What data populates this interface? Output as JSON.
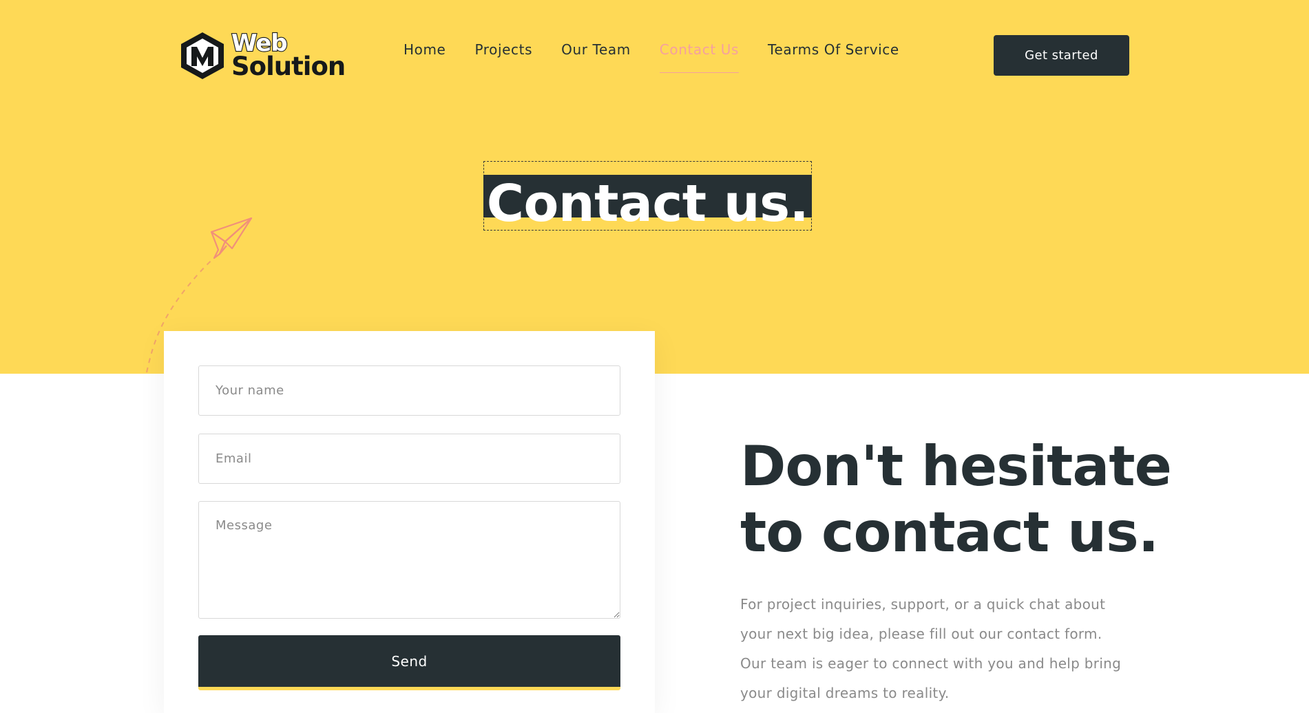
{
  "header": {
    "logo": {
      "line1": "Web",
      "line2": "Solution"
    },
    "nav": [
      {
        "label": "Home",
        "active": false
      },
      {
        "label": "Projects",
        "active": false
      },
      {
        "label": "Our Team",
        "active": false
      },
      {
        "label": "Contact Us",
        "active": true
      },
      {
        "label": "Tearms Of Service",
        "active": false
      }
    ],
    "cta_label": "Get started"
  },
  "hero": {
    "title": "Contact us."
  },
  "form": {
    "name_placeholder": "Your name",
    "email_placeholder": "Email",
    "message_placeholder": "Message",
    "send_label": "Send"
  },
  "info": {
    "heading": "Don't hesitate to contact us.",
    "body": "For project inquiries, support, or a quick chat about your next big idea, please fill out our contact form. Our team is eager to connect with you and help bring your digital dreams to reality."
  },
  "colors": {
    "hero_background": "#fed956",
    "dark": "#263034",
    "active_nav": "#f5a09f",
    "muted_text": "#8a8a8a"
  },
  "icons": {
    "logo": "web-solution-logo-icon",
    "decoration": "paper-plane-icon"
  }
}
